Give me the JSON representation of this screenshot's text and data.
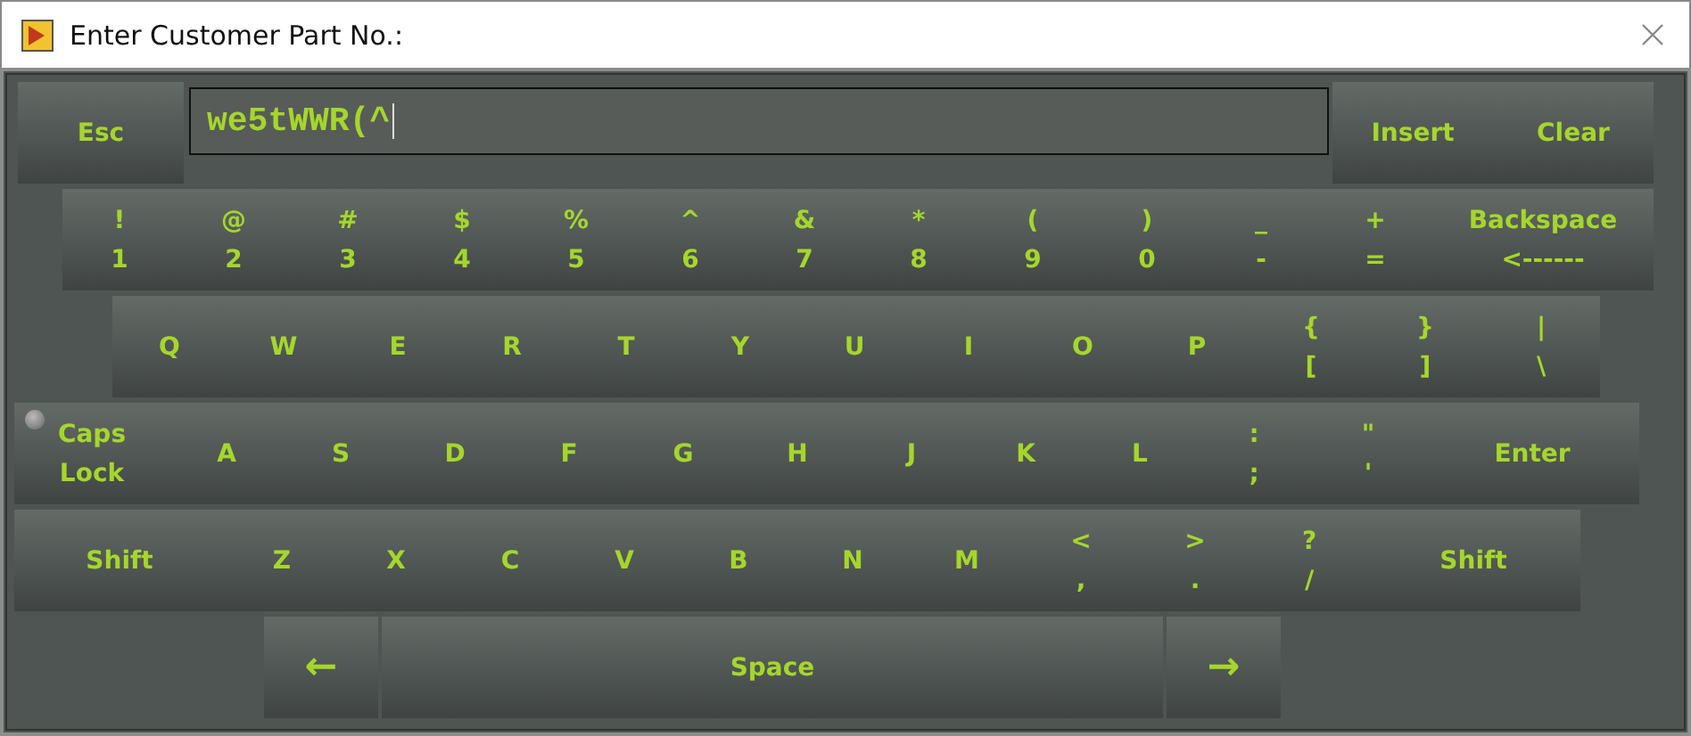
{
  "window": {
    "title": "Enter Customer Part No.:"
  },
  "entry": {
    "value": "we5tWWR(^"
  },
  "top_left_keys": [
    {
      "label": "Esc"
    }
  ],
  "top_right_keys": [
    {
      "label": "Insert"
    },
    {
      "label": "Clear"
    }
  ],
  "rows": [
    {
      "keys": [
        {
          "kind": "dual",
          "upper": "!",
          "lower": "1"
        },
        {
          "kind": "dual",
          "upper": "@",
          "lower": "2"
        },
        {
          "kind": "dual",
          "upper": "#",
          "lower": "3"
        },
        {
          "kind": "dual",
          "upper": "$",
          "lower": "4"
        },
        {
          "kind": "dual",
          "upper": "%",
          "lower": "5"
        },
        {
          "kind": "dual",
          "upper": "^",
          "lower": "6"
        },
        {
          "kind": "dual",
          "upper": "&",
          "lower": "7"
        },
        {
          "kind": "dual",
          "upper": "*",
          "lower": "8"
        },
        {
          "kind": "dual",
          "upper": "(",
          "lower": "9"
        },
        {
          "kind": "dual",
          "upper": ")",
          "lower": "0"
        },
        {
          "kind": "dual",
          "upper": "_",
          "lower": "-"
        },
        {
          "kind": "dual",
          "upper": "+",
          "lower": "="
        },
        {
          "kind": "dual",
          "upper": "Backspace",
          "lower": "<------"
        }
      ]
    },
    {
      "keys": [
        {
          "kind": "char",
          "label": "Q"
        },
        {
          "kind": "char",
          "label": "W"
        },
        {
          "kind": "char",
          "label": "E"
        },
        {
          "kind": "char",
          "label": "R"
        },
        {
          "kind": "char",
          "label": "T"
        },
        {
          "kind": "char",
          "label": "Y"
        },
        {
          "kind": "char",
          "label": "U"
        },
        {
          "kind": "char",
          "label": "I"
        },
        {
          "kind": "char",
          "label": "O"
        },
        {
          "kind": "char",
          "label": "P"
        },
        {
          "kind": "dual",
          "upper": "{",
          "lower": "["
        },
        {
          "kind": "dual",
          "upper": "}",
          "lower": "]"
        },
        {
          "kind": "dual",
          "upper": "|",
          "lower": "\\"
        }
      ]
    },
    {
      "keys": [
        {
          "kind": "toggle",
          "upper": "Caps",
          "lower": "Lock",
          "on": false
        },
        {
          "kind": "char",
          "label": "A"
        },
        {
          "kind": "char",
          "label": "S"
        },
        {
          "kind": "char",
          "label": "D"
        },
        {
          "kind": "char",
          "label": "F"
        },
        {
          "kind": "char",
          "label": "G"
        },
        {
          "kind": "char",
          "label": "H"
        },
        {
          "kind": "char",
          "label": "J"
        },
        {
          "kind": "char",
          "label": "K"
        },
        {
          "kind": "char",
          "label": "L"
        },
        {
          "kind": "dual",
          "upper": ":",
          "lower": ";"
        },
        {
          "kind": "dual",
          "upper": "\"",
          "lower": "'"
        },
        {
          "kind": "char",
          "label": "Enter"
        }
      ]
    },
    {
      "keys": [
        {
          "kind": "char",
          "label": "Shift"
        },
        {
          "kind": "char",
          "label": "Z"
        },
        {
          "kind": "char",
          "label": "X"
        },
        {
          "kind": "char",
          "label": "C"
        },
        {
          "kind": "char",
          "label": "V"
        },
        {
          "kind": "char",
          "label": "B"
        },
        {
          "kind": "char",
          "label": "N"
        },
        {
          "kind": "char",
          "label": "M"
        },
        {
          "kind": "dual",
          "upper": "<",
          "lower": ","
        },
        {
          "kind": "dual",
          "upper": ">",
          "lower": "."
        },
        {
          "kind": "dual",
          "upper": "?",
          "lower": "/"
        },
        {
          "kind": "char",
          "label": "Shift"
        }
      ]
    }
  ],
  "bottom_keys": [
    {
      "label": "←"
    },
    {
      "label": "Space"
    },
    {
      "label": "→"
    }
  ]
}
